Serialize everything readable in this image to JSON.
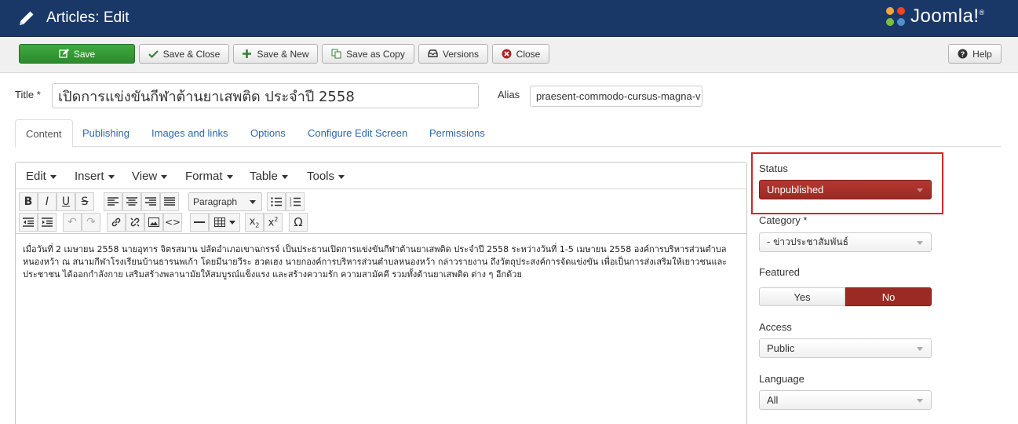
{
  "header": {
    "title": "Articles: Edit",
    "brand": "Joomla!",
    "brand_mark": "®"
  },
  "toolbar": {
    "save": "Save",
    "save_close": "Save & Close",
    "save_new": "Save & New",
    "save_copy": "Save as Copy",
    "versions": "Versions",
    "close": "Close",
    "help": "Help"
  },
  "form": {
    "title_label": "Title *",
    "title_value": "เปิดการแข่งขันกีฬาต้านยาเสพติด ประจำปี 2558",
    "alias_label": "Alias",
    "alias_value": "praesent-commodo-cursus-magna-v"
  },
  "tabs": [
    {
      "label": "Content"
    },
    {
      "label": "Publishing"
    },
    {
      "label": "Images and links"
    },
    {
      "label": "Options"
    },
    {
      "label": "Configure Edit Screen"
    },
    {
      "label": "Permissions"
    }
  ],
  "editor": {
    "menus": [
      "Edit",
      "Insert",
      "View",
      "Format",
      "Table",
      "Tools"
    ],
    "format_select": "Paragraph",
    "body_text": "เมื่อวันที่ 2 เมษายน 2558 นายอุทาร จิตรสมาน ปลัดอำเภอเขาฉกรรจ์ เป็นประธานเปิดการแข่งขันกีฬาต้านยาเสพติด  ประจำปี 2558 ระหว่างวันที่ 1-5 เมษายน 2558 องค์การบริหารส่วนตำบลหนองหว้า ณ สนามกีฬาโรงเรียนบ้านธารนพเก้า โดยมีนายวีระ ฮวดเฮง นายกองค์การบริหารส่วนตำบลหนองหว้า กล่าวรายงาน ถึงวัตถุประสงค์การจัดแข่งขัน เพื่อเป็นการส่งเสริมให้เยาวชนและประชาชน ได้ออกกำลังกาย เสริมสร้างพลานามัยให้สมบูรณ์แข็งแรง  และสร้างความรัก ความสามัคคี รวมทั้งต้านยาเสพติด ต่าง ๆ อีกด้วย"
  },
  "sidebar": {
    "status_label": "Status",
    "status_value": "Unpublished",
    "category_label": "Category *",
    "category_value": "- ข่าวประชาสัมพันธ์",
    "featured_label": "Featured",
    "featured_yes": "Yes",
    "featured_no": "No",
    "access_label": "Access",
    "access_value": "Public",
    "language_label": "Language",
    "language_value": "All"
  },
  "colors": {
    "header_bg": "#1a3867",
    "save_green": "#2d8a2d",
    "status_red": "#9b2a24",
    "link_blue": "#2a69b2",
    "highlight_red": "#d62424"
  },
  "icons": {
    "header": "pencil-icon",
    "save": "edit-icon",
    "save_close": "check-icon",
    "save_new": "plus-icon",
    "save_copy": "copy-icon",
    "versions": "archive-icon",
    "close": "cancel-circle-icon",
    "help": "question-circle-icon"
  }
}
